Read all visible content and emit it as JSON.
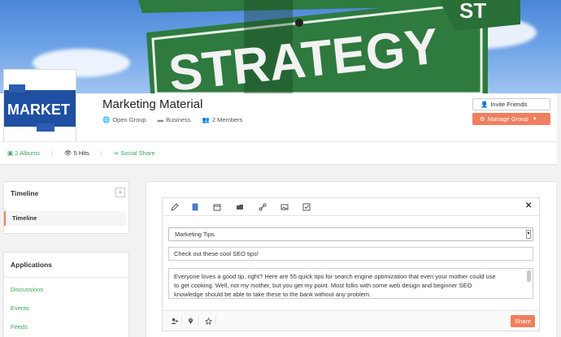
{
  "cover": {
    "sign_text": "STRATEGY",
    "sign_corner_text": "ST"
  },
  "group": {
    "logo_text": "MARKET",
    "title": "Marketing Material",
    "privacy": "Open Group",
    "category": "Business",
    "members": "2 Members",
    "invite_label": "Invite Friends",
    "manage_label": "Manage Group",
    "albums": "2 Albums",
    "hits": "5 Hits",
    "social_share": "Social Share"
  },
  "sidebar": {
    "timeline_heading": "Timeline",
    "timeline_item": "Timeline",
    "applications_heading": "Applications",
    "apps": [
      "Discussions",
      "Events",
      "Feeds"
    ]
  },
  "composer": {
    "tabs": [
      "pencil-icon",
      "page-icon",
      "calendar-icon",
      "folder-icon",
      "link-icon",
      "image-icon",
      "checkbox-icon"
    ],
    "close_label": "✕",
    "select_value": "Marketing Tips",
    "title_value": "Check out these cool SEO tips!",
    "body_lines": [
      "Everyone loves a good tip, right? Here are 55 quick tips for search engine optimization that even your mother could use",
      "to get cooking. Well, not my mother, but you get my point. Most folks with some web design and beginner SEO",
      "knowledge should be able to take these to the bank without any problem."
    ],
    "share_label": "Share"
  },
  "colors": {
    "accent": "#ef7f5e",
    "link": "#3ba55c",
    "sign_green": "#2f7a3e"
  }
}
